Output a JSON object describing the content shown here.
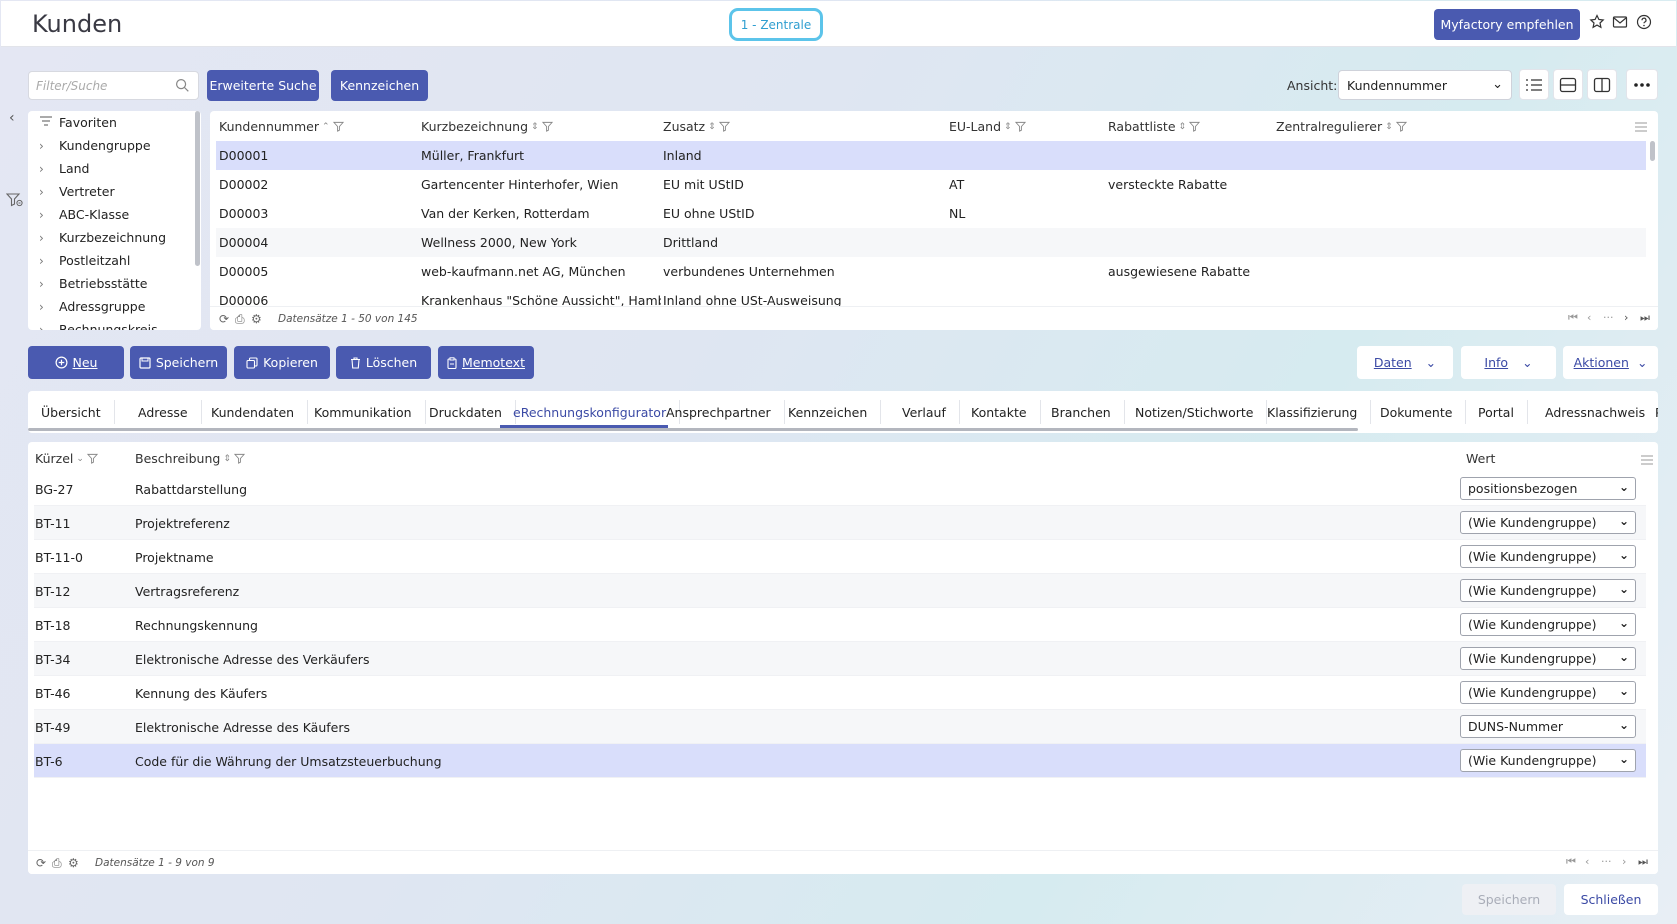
{
  "header": {
    "title": "Kunden",
    "company": "1 - Zentrale",
    "recommend_label": "Myfactory empfehlen",
    "icons": [
      "star-icon",
      "mail-icon",
      "help-icon"
    ]
  },
  "search": {
    "placeholder": "Filter/Suche"
  },
  "toolbar": {
    "advanced_search": "Erweiterte Suche",
    "marker": "Kennzeichen",
    "view_label": "Ansicht:",
    "view_value": "Kundennummer"
  },
  "tree": {
    "items": [
      {
        "label": "Favoriten",
        "icon": "filter-lines-icon"
      },
      {
        "label": "Kundengruppe",
        "icon": "chevron-right-icon"
      },
      {
        "label": "Land",
        "icon": "chevron-right-icon"
      },
      {
        "label": "Vertreter",
        "icon": "chevron-right-icon"
      },
      {
        "label": "ABC-Klasse",
        "icon": "chevron-right-icon"
      },
      {
        "label": "Kurzbezeichnung",
        "icon": "chevron-right-icon"
      },
      {
        "label": "Postleitzahl",
        "icon": "chevron-right-icon"
      },
      {
        "label": "Betriebsstätte",
        "icon": "chevron-right-icon"
      },
      {
        "label": "Adressgruppe",
        "icon": "chevron-right-icon"
      },
      {
        "label": "Rechnungskreis",
        "icon": "chevron-right-icon"
      }
    ]
  },
  "grid": {
    "columns": [
      "Kundennummer",
      "Kurzbezeichnung",
      "Zusatz",
      "EU-Land",
      "Rabattliste",
      "Zentralregulierer"
    ],
    "rows": [
      [
        "D00001",
        "Müller, Frankfurt",
        "Inland",
        "",
        "",
        ""
      ],
      [
        "D00002",
        "Gartencenter Hinterhofer, Wien",
        "EU mit UStID",
        "AT",
        "versteckte Rabatte",
        ""
      ],
      [
        "D00003",
        "Van der Kerken, Rotterdam",
        "EU ohne UStID",
        "NL",
        "",
        ""
      ],
      [
        "D00004",
        "Wellness 2000, New York",
        "Drittland",
        "",
        "",
        ""
      ],
      [
        "D00005",
        "web-kaufmann.net AG, München",
        "verbundenes Unternehmen",
        "",
        "ausgewiesene Rabatte",
        ""
      ],
      [
        "D00006",
        "Krankenhaus \"Schöne Aussicht\", Hamburg",
        "Inland ohne USt-Ausweisung",
        "",
        "",
        ""
      ]
    ],
    "footer": "Datensätze 1 - 50 von 145"
  },
  "actions": {
    "new": "Neu",
    "save": "Speichern",
    "copy": "Kopieren",
    "delete": "Löschen",
    "memo": "Memotext",
    "data": "Daten",
    "info": "Info",
    "more": "Aktionen"
  },
  "tabs": [
    "Übersicht",
    "Adresse",
    "Kundendaten",
    "Kommunikation",
    "Druckdaten",
    "eRechnungskonfigurator",
    "Ansprechpartner",
    "Kennzeichen",
    "Verlauf",
    "Kontakte",
    "Branchen",
    "Notizen/Stichworte",
    "Klassifizierung",
    "Dokumente",
    "Portal",
    "Adressnachweis",
    "P"
  ],
  "active_tab": "eRechnungskonfigurator",
  "detail": {
    "columns": [
      "Kürzel",
      "Beschreibung",
      "Wert"
    ],
    "rows": [
      [
        "BG-27",
        "Rabattdarstellung",
        "positionsbezogen"
      ],
      [
        "BT-11",
        "Projektreferenz",
        "(Wie Kundengruppe)"
      ],
      [
        "BT-11-0",
        "Projektname",
        "(Wie Kundengruppe)"
      ],
      [
        "BT-12",
        "Vertragsreferenz",
        "(Wie Kundengruppe)"
      ],
      [
        "BT-18",
        "Rechnungskennung",
        "(Wie Kundengruppe)"
      ],
      [
        "BT-34",
        "Elektronische Adresse des Verkäufers",
        "(Wie Kundengruppe)"
      ],
      [
        "BT-46",
        "Kennung des Käufers",
        "(Wie Kundengruppe)"
      ],
      [
        "BT-49",
        "Elektronische Adresse des Käufers",
        "DUNS-Nummer"
      ],
      [
        "BT-6",
        "Code für die Währung der Umsatzsteuerbuchung",
        "(Wie Kundengruppe)"
      ]
    ],
    "footer": "Datensätze 1 - 9 von 9"
  },
  "bottom": {
    "save": "Speichern",
    "close": "Schließen"
  },
  "colors": {
    "primary": "#4a5ab0",
    "accent": "#5cc4ea",
    "selected_row": "#d9defb"
  }
}
